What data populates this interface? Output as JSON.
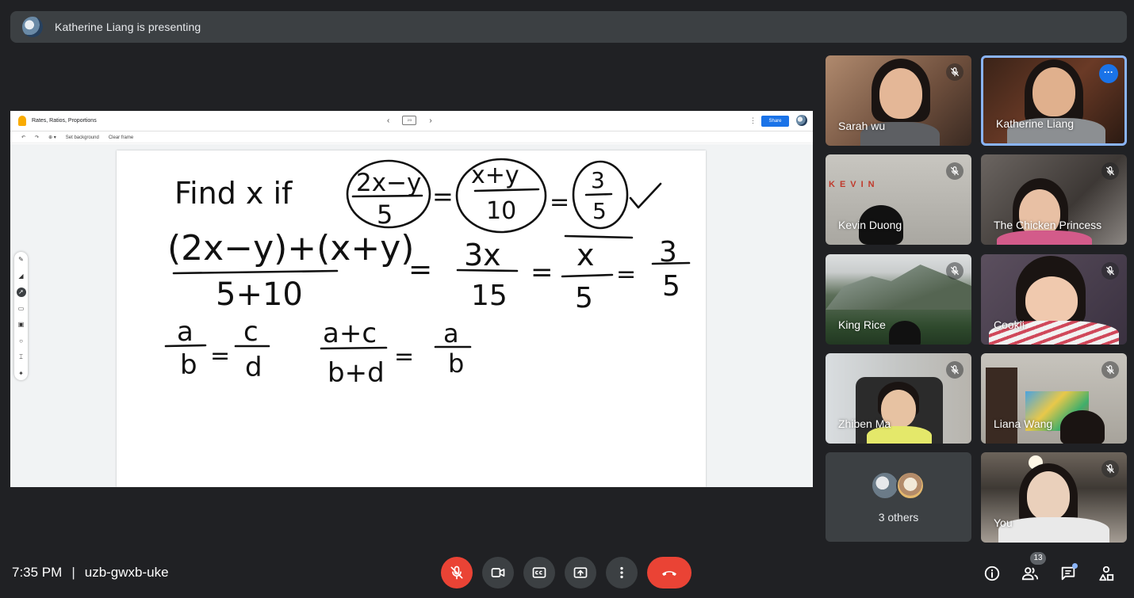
{
  "banner": {
    "text": "Katherine Liang is presenting"
  },
  "jamboard": {
    "title": "Rates, Ratios, Proportions",
    "share_label": "Share",
    "tools": {
      "set_background": "Set background",
      "clear_frame": "Clear frame"
    },
    "frame_indicator": "2/3",
    "handwriting": {
      "line1": [
        "Find x if",
        "2x−y",
        "5",
        "=",
        "x+y",
        "10",
        "=",
        "3",
        "5"
      ],
      "line2": [
        "(2x−y)+(x+y)",
        "5+10",
        "=",
        "3x",
        "15",
        "=",
        "x",
        "5",
        "=",
        "3",
        "5"
      ],
      "line3": [
        "a",
        "b",
        "=",
        "c",
        "d",
        "a+c",
        "b+d",
        "=",
        "a",
        "b"
      ]
    }
  },
  "participants": [
    {
      "name": "Sarah wu",
      "muted": true
    },
    {
      "name": "Katherine Liang",
      "muted": false,
      "active_speaker": true
    },
    {
      "name": "Kevin Duong",
      "muted": true,
      "wall_text": "KEVIN"
    },
    {
      "name": "The Chicken Princess",
      "muted": true
    },
    {
      "name": "King Rice",
      "muted": true
    },
    {
      "name": "Cookii",
      "muted": true
    },
    {
      "name": "Zhiben Ma",
      "muted": true
    },
    {
      "name": "Liana Wang",
      "muted": true
    },
    {
      "name": "You",
      "muted": true
    }
  ],
  "others_tile": {
    "label": "3 others"
  },
  "meeting": {
    "time": "7:35 PM",
    "separator": "|",
    "code": "uzb-gwxb-uke"
  },
  "controls": [
    "mic-off",
    "camera",
    "captions",
    "present",
    "more-options",
    "leave-call"
  ],
  "right_controls": {
    "people_count": "13"
  },
  "colors": {
    "background": "#202124",
    "surface": "#3c4043",
    "danger": "#ea4335",
    "accent": "#8ab4f8",
    "share": "#1a73e8"
  }
}
